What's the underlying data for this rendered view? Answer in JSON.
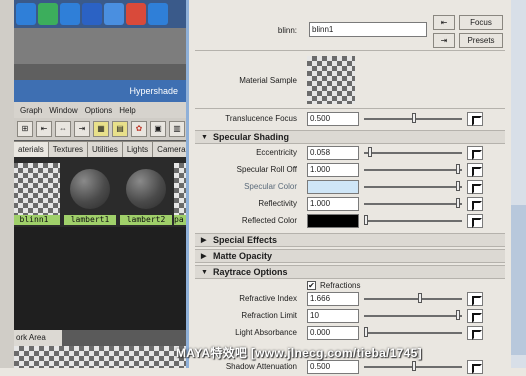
{
  "hypershade": {
    "title": "Hypershade",
    "menu": [
      "Graph",
      "Window",
      "Options",
      "Help"
    ],
    "tabs": [
      "aterials",
      "Textures",
      "Utilities",
      "Lights",
      "Camera"
    ],
    "swatches": [
      "blinn1",
      "lambert1",
      "lambert2",
      "pa"
    ],
    "work_area_tab": "ork Area"
  },
  "attr_header": {
    "shader_label": "blinn:",
    "shader_name": "blinn1",
    "focus_btn": "Focus",
    "presets_btn": "Presets",
    "material_sample_label": "Material Sample"
  },
  "rows": {
    "translucence_focus": {
      "label": "Translucence Focus",
      "value": "0.500"
    },
    "eccentricity": {
      "label": "Eccentricity",
      "value": "0.058"
    },
    "specular_rolloff": {
      "label": "Specular Roll Off",
      "value": "1.000"
    },
    "specular_color": {
      "label": "Specular Color",
      "color": "#cfe6f7"
    },
    "reflectivity": {
      "label": "Reflectivity",
      "value": "1.000"
    },
    "reflected_color": {
      "label": "Reflected Color",
      "color": "#000000"
    },
    "refractions": {
      "label": "Refractions",
      "checked": true
    },
    "refractive_index": {
      "label": "Refractive Index",
      "value": "1.666"
    },
    "refraction_limit": {
      "label": "Refraction Limit",
      "value": "10"
    },
    "light_absorbance": {
      "label": "Light Absorbance",
      "value": "0.000"
    },
    "shadow_attenuation": {
      "label": "Shadow Attenuation",
      "value": "0.500"
    }
  },
  "sections": {
    "specular_shading": "Specular Shading",
    "special_effects": "Special Effects",
    "matte_opacity": "Matte Opacity",
    "raytrace_options": "Raytrace Options"
  },
  "watermark": "MAYA特效吧 [www.jlnecg.com/tieba/1745]",
  "colors": {
    "hypershade_title_bg": "#3e6fb2",
    "swatch_label_bg": "#a0d06a",
    "scrollbar": "#b8c8dc"
  }
}
